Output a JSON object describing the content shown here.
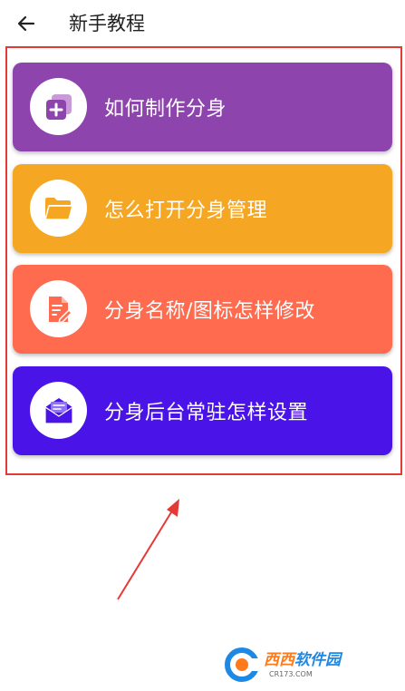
{
  "header": {
    "title": "新手教程",
    "back_icon": "arrow-left-icon"
  },
  "tutorials": [
    {
      "label": "如何制作分身",
      "color": "#8e44ad",
      "icon": "add-square-icon",
      "icon_color": "#8e44ad"
    },
    {
      "label": "怎么打开分身管理",
      "color": "#f5a623",
      "icon": "folder-icon",
      "icon_color": "#f5a623"
    },
    {
      "label": "分身名称/图标怎样修改",
      "color": "#ff6b4f",
      "icon": "edit-document-icon",
      "icon_color": "#ff6b4f"
    },
    {
      "label": "分身后台常驻怎样设置",
      "color": "#4a14e8",
      "icon": "mail-envelope-icon",
      "icon_color": "#4a14e8"
    }
  ],
  "annotation": {
    "highlight_color": "#e53935"
  },
  "watermark": {
    "brand_part1": "西西",
    "brand_part2": "软件园",
    "url": "CR173.COM"
  }
}
